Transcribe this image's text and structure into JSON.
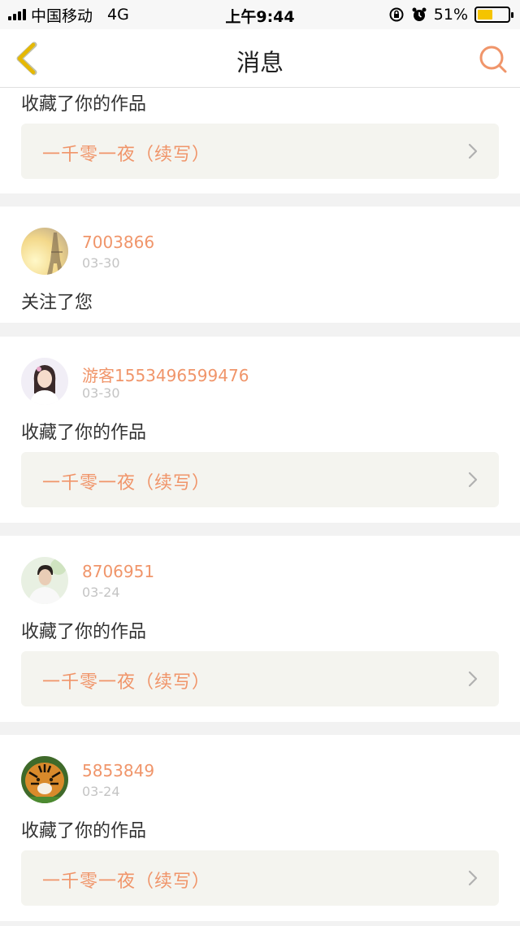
{
  "status_bar": {
    "carrier": "中国移动",
    "network": "4G",
    "time": "上午9:44",
    "battery": "51%",
    "battery_level": 0.51
  },
  "nav": {
    "title": "消息",
    "back_icon": "chevron-left-icon",
    "search_icon": "search-icon"
  },
  "colors": {
    "accent": "#f0956a",
    "back_arrow": "#e6b800",
    "work_bg": "#f4f4ef"
  },
  "messages": [
    {
      "action": "收藏了你的作品",
      "work": "一千零一夜（续写）"
    },
    {
      "username": "7003866",
      "date": "03-30",
      "action": "关注了您",
      "avatar": "eiffel-tower-avatar"
    },
    {
      "username": "游客1553496599476",
      "date": "03-30",
      "action": "收藏了你的作品",
      "work": "一千零一夜（续写）",
      "avatar": "girl-avatar"
    },
    {
      "username": "8706951",
      "date": "03-24",
      "action": "收藏了你的作品",
      "work": "一千零一夜（续写）",
      "avatar": "man-avatar"
    },
    {
      "username": "5853849",
      "date": "03-24",
      "action": "收藏了你的作品",
      "work": "一千零一夜（续写）",
      "avatar": "tiger-avatar"
    }
  ]
}
